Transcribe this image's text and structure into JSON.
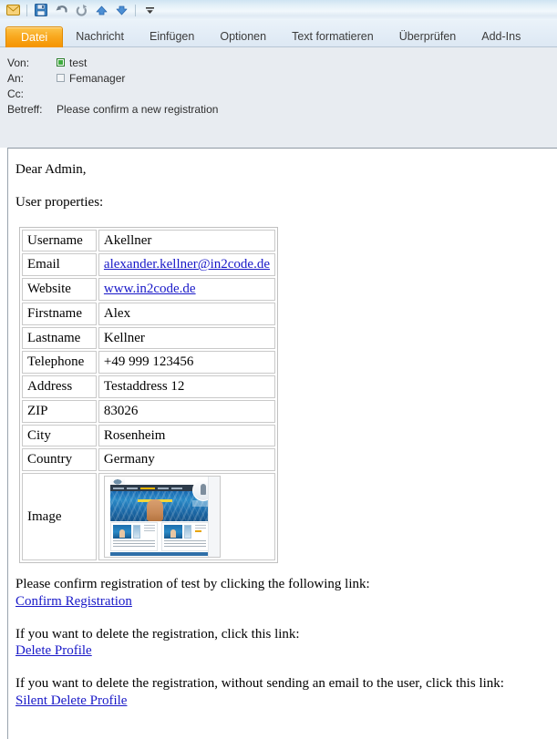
{
  "quick_access": {
    "items": [
      {
        "name": "envelope-icon",
        "label": "Nachricht"
      },
      {
        "name": "save-icon",
        "label": "Speichern"
      },
      {
        "name": "undo-icon",
        "label": "Rückgängig"
      },
      {
        "name": "redo-icon",
        "label": "Wiederherstellen"
      },
      {
        "name": "previous-item-icon",
        "label": "Vorheriges Element"
      },
      {
        "name": "next-item-icon",
        "label": "Nächstes Element"
      },
      {
        "name": "customize-chevron-icon",
        "label": "Symbolleiste anpassen"
      }
    ]
  },
  "ribbon": {
    "tabs": [
      {
        "label": "Datei",
        "active": true
      },
      {
        "label": "Nachricht",
        "active": false
      },
      {
        "label": "Einfügen",
        "active": false
      },
      {
        "label": "Optionen",
        "active": false
      },
      {
        "label": "Text formatieren",
        "active": false
      },
      {
        "label": "Überprüfen",
        "active": false
      },
      {
        "label": "Add-Ins",
        "active": false
      }
    ]
  },
  "header": {
    "from_label": "Von:",
    "from_value": "test",
    "from_status": "online",
    "to_label": "An:",
    "to_value": "Femanager",
    "to_status": "offline",
    "cc_label": "Cc:",
    "cc_value": "",
    "subject_label": "Betreff:",
    "subject_value": "Please confirm a new registration"
  },
  "mail": {
    "greeting": "Dear Admin,",
    "intro": "User properties:",
    "table": {
      "rows": [
        {
          "key": "Username",
          "value": "Akellner",
          "type": "text"
        },
        {
          "key": "Email",
          "value": "alexander.kellner@in2code.de",
          "type": "link"
        },
        {
          "key": "Website",
          "value": "www.in2code.de",
          "type": "link"
        },
        {
          "key": "Firstname",
          "value": "Alex",
          "type": "text"
        },
        {
          "key": "Lastname",
          "value": "Kellner",
          "type": "text"
        },
        {
          "key": "Telephone",
          "value": "+49 999 123456",
          "type": "text"
        },
        {
          "key": "Address",
          "value": "Testaddress 12",
          "type": "text"
        },
        {
          "key": "ZIP",
          "value": "83026",
          "type": "text"
        },
        {
          "key": "City",
          "value": "Rosenheim",
          "type": "text"
        },
        {
          "key": "Country",
          "value": "Germany",
          "type": "text"
        },
        {
          "key": "Image",
          "value": "website-screenshot-thumbnail",
          "type": "image"
        }
      ]
    },
    "confirm_text": "Please confirm registration of test by clicking the following link:",
    "confirm_link": "Confirm Registration",
    "delete_text": "If you want to delete the registration, click this link:",
    "delete_link": "Delete Profile",
    "silent_delete_text": "If you want to delete the registration, without sending an email to the user, click this link:",
    "silent_delete_link": "Silent Delete Profile"
  },
  "colors": {
    "file_tab": "#f9a920",
    "link": "#1818c8",
    "header_bg": "#e8ecf1",
    "presence_online": "#3fae3f"
  }
}
